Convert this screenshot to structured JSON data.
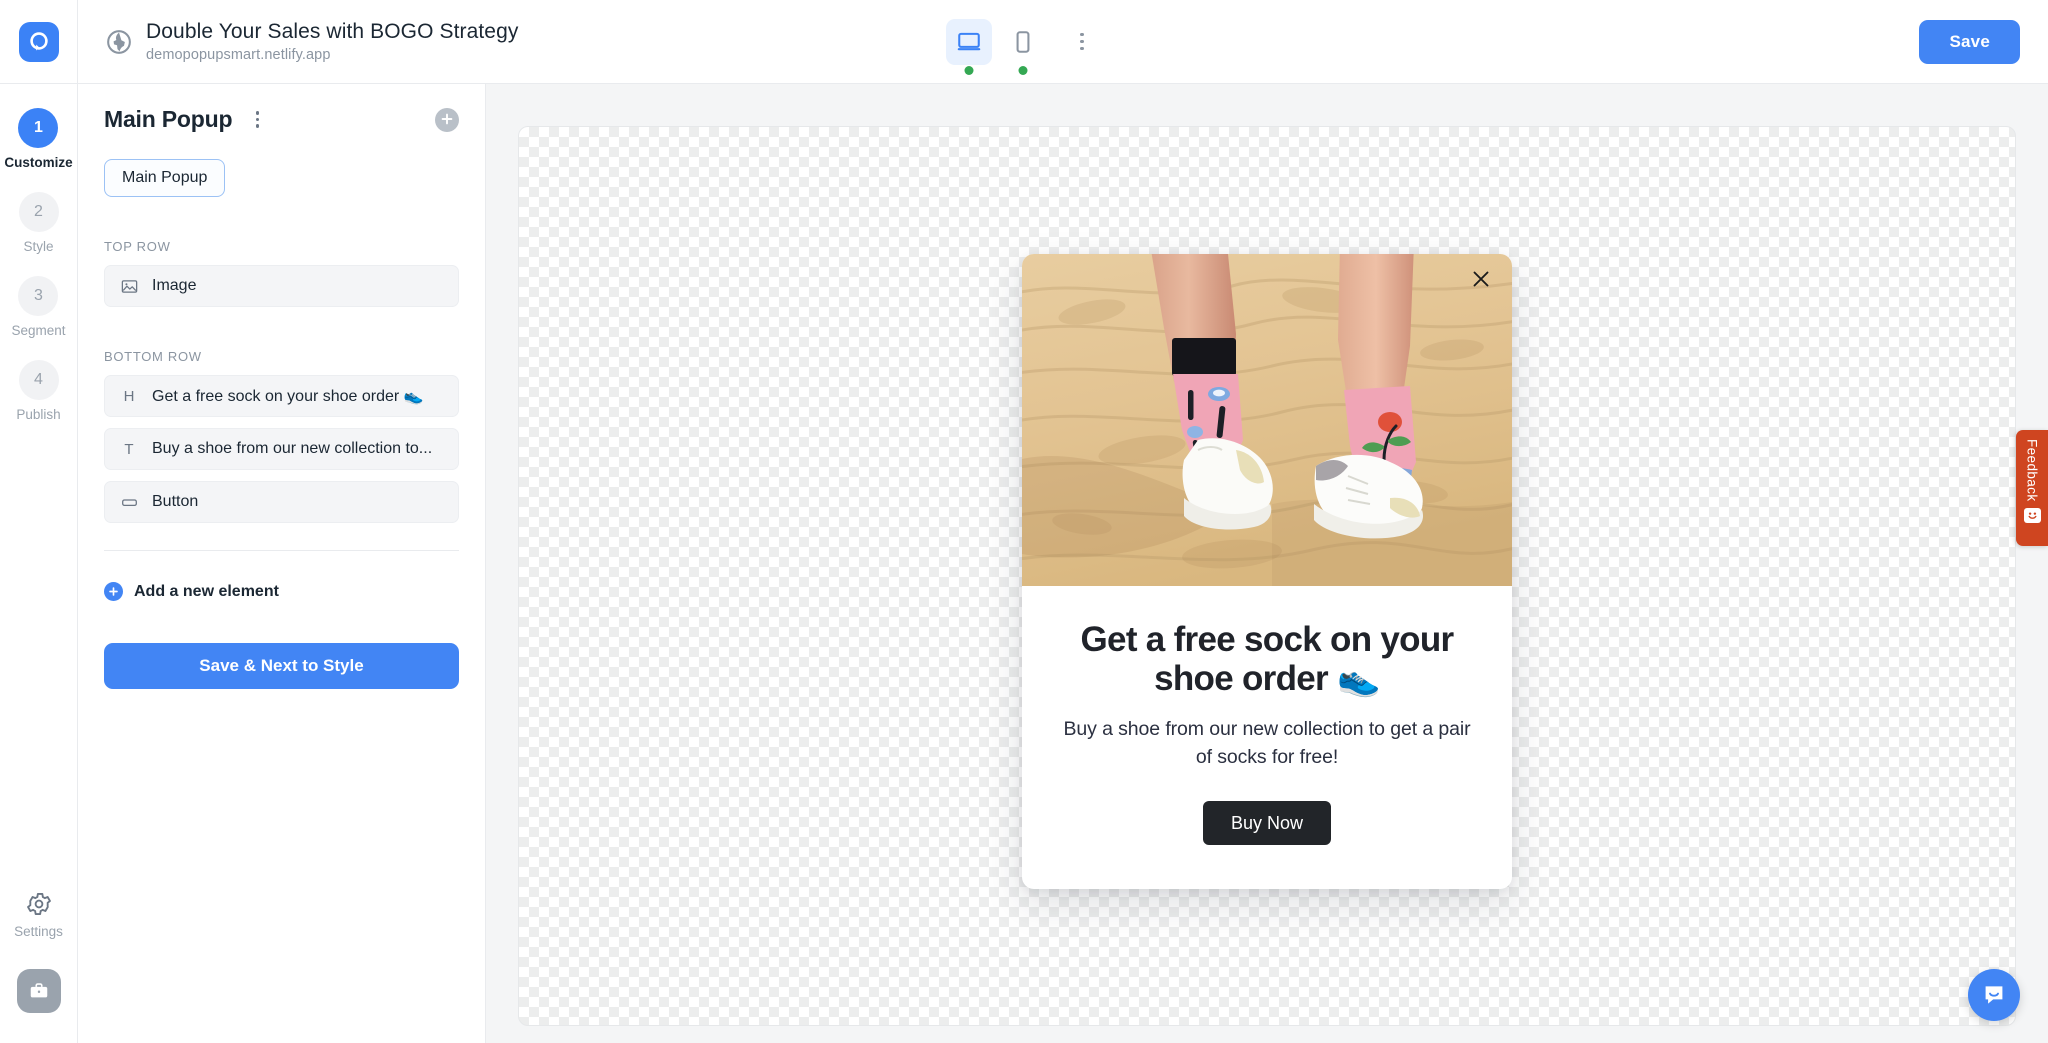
{
  "app": {
    "logo_icon": "popupsmart-logo-icon",
    "accent_color": "#4285f4",
    "active_step_color": "#3b82f6"
  },
  "header": {
    "site_icon": "globe-icon",
    "campaign_title": "Double Your Sales with BOGO Strategy",
    "campaign_url": "demopopupsmart.netlify.app",
    "devices": [
      {
        "name": "desktop-icon",
        "label": "Desktop",
        "active": true,
        "status_dot": true
      },
      {
        "name": "mobile-icon",
        "label": "Mobile",
        "active": false,
        "status_dot": true
      }
    ],
    "more_menu_icon": "kebab-menu-icon",
    "save_label": "Save"
  },
  "steps": [
    {
      "number": "1",
      "label": "Customize",
      "active": true
    },
    {
      "number": "2",
      "label": "Style",
      "active": false
    },
    {
      "number": "3",
      "label": "Segment",
      "active": false
    },
    {
      "number": "4",
      "label": "Publish",
      "active": false
    }
  ],
  "rail_bottom": {
    "settings_icon": "gear-icon",
    "settings_label": "Settings",
    "workspace_icon": "briefcase-icon"
  },
  "panel": {
    "title": "Main Popup",
    "kebab_icon": "kebab-menu-icon",
    "add_icon": "plus-circle-icon",
    "tab_label": "Main Popup",
    "sections": [
      {
        "label": "TOP ROW",
        "elements": [
          {
            "icon": "image-icon",
            "icon_glyph": "image",
            "name": "Image"
          }
        ]
      },
      {
        "label": "BOTTOM ROW",
        "elements": [
          {
            "icon": "heading-icon",
            "icon_glyph": "H",
            "name": "Get a free sock on your shoe order 👟"
          },
          {
            "icon": "text-icon",
            "icon_glyph": "T",
            "name": "Buy a shoe from our new collection to..."
          },
          {
            "icon": "button-icon",
            "icon_glyph": "button",
            "name": "Button"
          }
        ]
      }
    ],
    "add_element_label": "Add a new element",
    "add_element_icon": "plus-circle-icon",
    "next_button_label": "Save & Next to Style"
  },
  "preview": {
    "close_icon": "close-icon",
    "image_alt": "Legs wearing pink patterned socks and white sneakers standing on sand",
    "heading": "Get a free sock on your shoe order 👟",
    "paragraph": "Buy a shoe from our new collection to get a pair of socks for free!",
    "cta_label": "Buy Now",
    "cta_bg": "#222529"
  },
  "feedback": {
    "label": "Feedback",
    "icon": "smiley-face-icon",
    "color": "#cf4520"
  },
  "chat": {
    "icon": "chat-bubble-icon",
    "color": "#4285f4"
  }
}
